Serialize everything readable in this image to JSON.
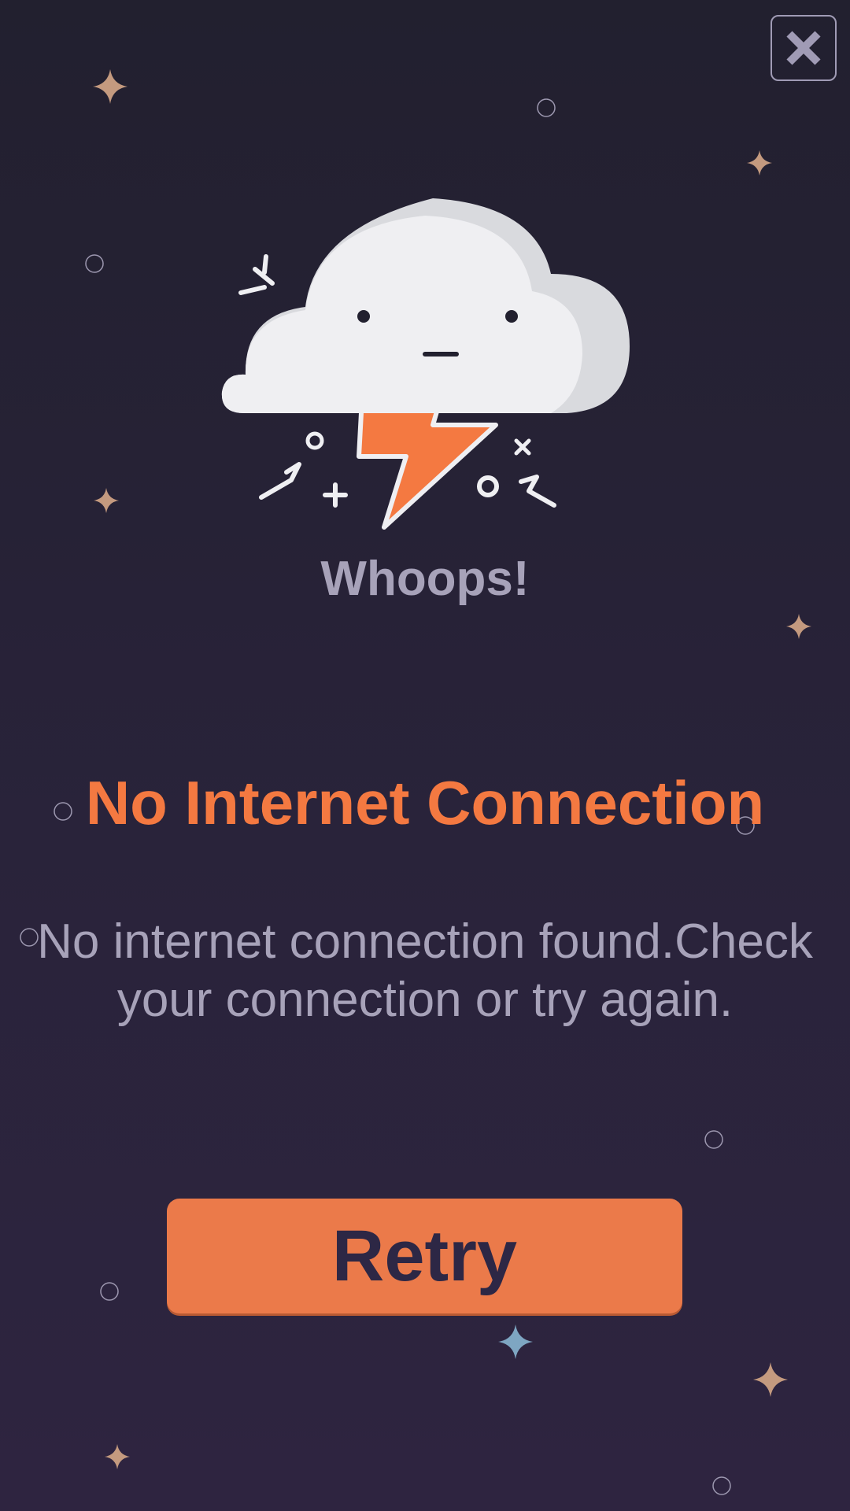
{
  "header": {
    "close_icon": "close-icon"
  },
  "illustration": {
    "icon": "cloud-lightning-icon",
    "accent_color": "#f47941"
  },
  "dialog": {
    "greeting": "Whoops!",
    "title": "No Internet Connection",
    "message_line1": "No internet connection found.Check",
    "message_line2": "your connection or try again.",
    "retry_label": "Retry"
  },
  "colors": {
    "background": "#24212f",
    "accent": "#f47941",
    "button": "#eb7a4a",
    "button_text": "#2d2745",
    "muted_text": "#a7a2b9",
    "star": "#c49a7f",
    "star_blue": "#7ea6c2"
  }
}
